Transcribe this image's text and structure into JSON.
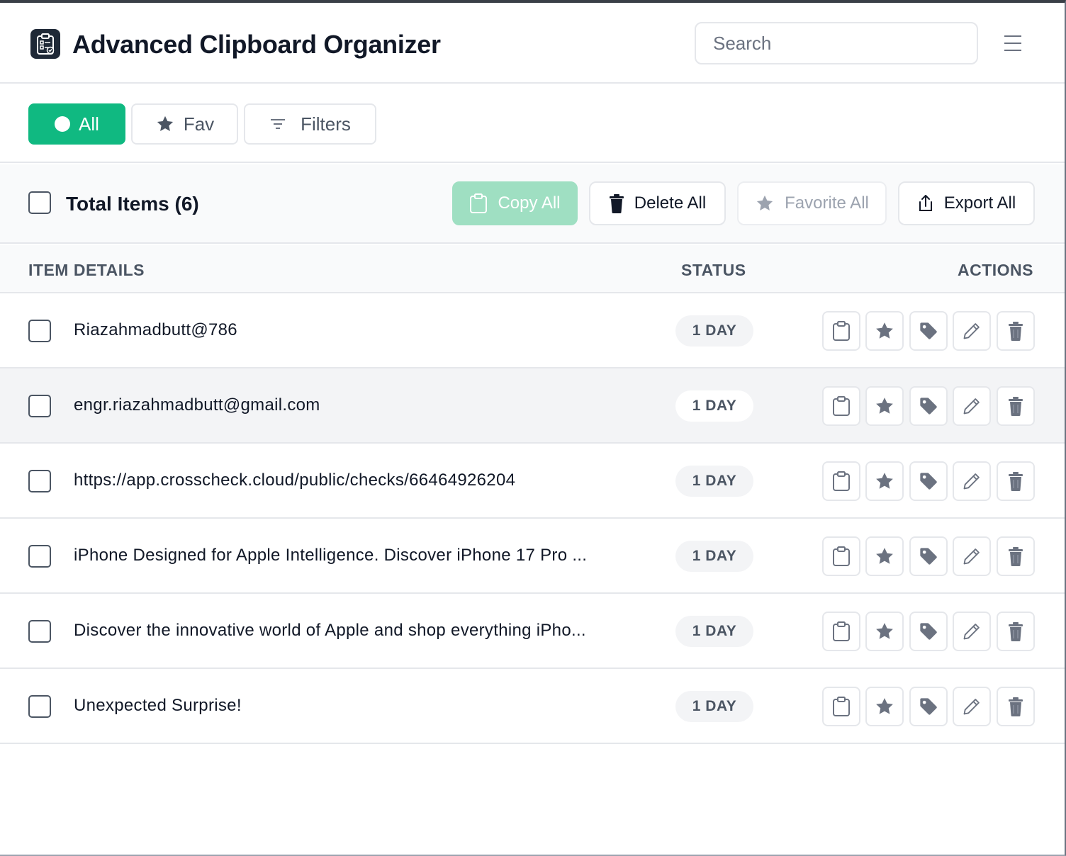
{
  "header": {
    "title": "Advanced Clipboard Organizer",
    "search_placeholder": "Search",
    "logo_icon": "clipboard-check-icon",
    "menu_icon": "hamburger-menu-icon"
  },
  "tabs": [
    {
      "label": "All",
      "icon": "dot-icon",
      "active": true
    },
    {
      "label": "Fav",
      "icon": "star-icon",
      "active": false
    },
    {
      "label": "Filters",
      "icon": "filter-icon",
      "active": false
    }
  ],
  "toolbar": {
    "total_label": "Total Items (6)",
    "copy_all": "Copy All",
    "delete_all": "Delete All",
    "favorite_all": "Favorite All",
    "export_all": "Export All"
  },
  "columns": {
    "details": "ITEM DETAILS",
    "status": "STATUS",
    "actions": "ACTIONS"
  },
  "items": [
    {
      "text": "Riazahmadbutt@786",
      "status": "1 DAY"
    },
    {
      "text": "engr.riazahmadbutt@gmail.com",
      "status": "1 DAY"
    },
    {
      "text": "https://app.crosscheck.cloud/public/checks/66464926204",
      "status": "1 DAY"
    },
    {
      "text": "iPhone Designed for Apple Intelligence. Discover iPhone 17 Pro ...",
      "status": "1 DAY"
    },
    {
      "text": "Discover the innovative world of Apple and shop everything iPho...",
      "status": "1 DAY"
    },
    {
      "text": "Unexpected Surprise!",
      "status": "1 DAY"
    }
  ],
  "colors": {
    "accent": "#10b981",
    "accent_disabled": "#9fdfc2",
    "icon_gray": "#6b7280"
  }
}
